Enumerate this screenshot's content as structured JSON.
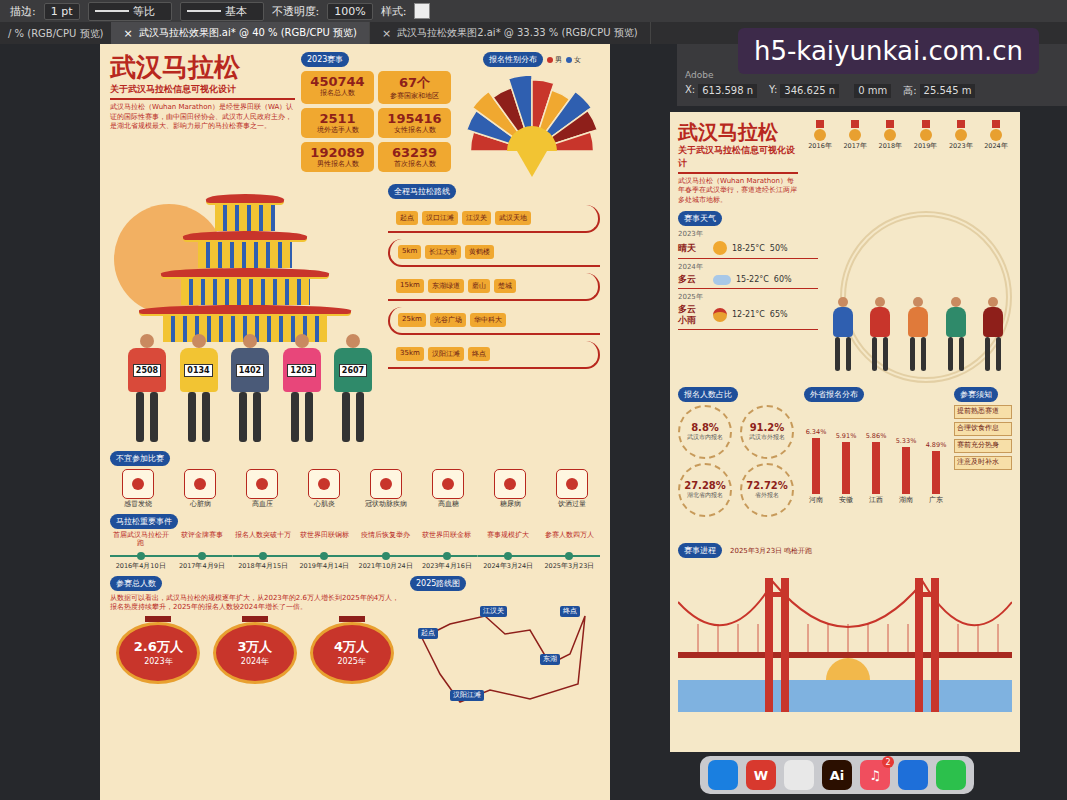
{
  "toolbar": {
    "stroke_label": "描边:",
    "stroke_value": "1 pt",
    "profile": "等比",
    "brush": "基本",
    "opacity_label": "不透明度:",
    "opacity_value": "100%",
    "style_label": "样式:"
  },
  "left_tab_stub": "/ % (RGB/CPU 预览)",
  "tabs": [
    {
      "label": "武汉马拉松效果图.ai* @ 40 % (RGB/CPU 预览)",
      "selected": true
    },
    {
      "label": "武汉马拉松效果图2.ai* @ 33.33 % (RGB/CPU 预览)",
      "selected": false
    }
  ],
  "tab_close": "×",
  "app_label": "Adobe",
  "watermark": "h5-kaiyunkai.com.cn",
  "transform": [
    {
      "label": "X:",
      "value": "613.598 n"
    },
    {
      "label": "Y:",
      "value": "346.625 n"
    },
    {
      "label": "",
      "value": "0 mm"
    },
    {
      "label": "高:",
      "value": "25.545 m"
    }
  ],
  "board1": {
    "title": "武汉马拉松",
    "subtitle": "关于武汉马拉松信息可视化设计",
    "intro": "武汉马拉松（Wuhan Marathon）是经世界田联（WA）认证的国际性赛事，由中国田径协会、武汉市人民政府主办，是湖北省规模最大、影响力最广的马拉松赛事之一。",
    "stats_title": "2023赛事",
    "stats": [
      {
        "value": "450744",
        "label": "报名总人数"
      },
      {
        "value": "67个",
        "label": "参赛国家和地区"
      },
      {
        "value": "2511",
        "label": "境外选手人数"
      },
      {
        "value": "195416",
        "label": "女性报名人数"
      },
      {
        "value": "192089",
        "label": "男性报名人数"
      },
      {
        "value": "63239",
        "label": "首次报名人数"
      }
    ],
    "fan_title": "报名性别分布",
    "fan_legend": [
      {
        "label": "男",
        "color": "#c8352b"
      },
      {
        "label": "女",
        "color": "#2f5fb0"
      }
    ],
    "fan_segments": [
      {
        "color": "#c8352b",
        "level": 0.7
      },
      {
        "color": "#2f5fb0",
        "level": 0.85
      },
      {
        "color": "#f0a830",
        "level": 0.95
      },
      {
        "color": "#8e1f1a",
        "level": 0.8
      },
      {
        "color": "#2f5fb0",
        "level": 1
      },
      {
        "color": "#c8352b",
        "level": 0.9
      },
      {
        "color": "#f0a830",
        "level": 0.75
      },
      {
        "color": "#2f5fb0",
        "level": 0.95
      },
      {
        "color": "#8e1f1a",
        "level": 0.85
      },
      {
        "color": "#c8352b",
        "level": 0.7
      }
    ],
    "bibs": [
      {
        "number": "2508",
        "color": "#d94a3a"
      },
      {
        "number": "0134",
        "color": "#f2c433"
      },
      {
        "number": "1402",
        "color": "#4a5a78"
      },
      {
        "number": "1203",
        "color": "#e8467a"
      },
      {
        "number": "2607",
        "color": "#2f8a6a"
      }
    ],
    "route_title": "全程马拉松路线",
    "route_rows": [
      [
        "起点",
        "汉口江滩",
        "江汉关",
        "武汉天地"
      ],
      [
        "5km",
        "长江大桥",
        "黄鹤楼"
      ],
      [
        "15km",
        "东湖绿道",
        "磨山",
        "楚城"
      ],
      [
        "25km",
        "光谷广场",
        "华中科大"
      ],
      [
        "35km",
        "汉阳江滩",
        "终点"
      ]
    ],
    "warn_title": "不宜参加比赛",
    "warn_items": [
      "感冒发烧",
      "心脏病",
      "高血压",
      "心肌炎",
      "冠状动脉疾病",
      "高血糖",
      "糖尿病",
      "饮酒过量"
    ],
    "events_title": "马拉松重要事件",
    "events": [
      {
        "date": "2016年4月10日",
        "text": "首届武汉马拉松开跑"
      },
      {
        "date": "2017年4月9日",
        "text": "获评金牌赛事"
      },
      {
        "date": "2018年4月15日",
        "text": "报名人数突破十万"
      },
      {
        "date": "2019年4月14日",
        "text": "获世界田联铜标"
      },
      {
        "date": "2021年10月24日",
        "text": "疫情后恢复举办"
      },
      {
        "date": "2023年4月16日",
        "text": "获世界田联金标"
      },
      {
        "date": "2024年3月24日",
        "text": "赛事规模扩大"
      },
      {
        "date": "2025年3月23日",
        "text": "参赛人数四万人"
      }
    ],
    "totals_title": "参赛总人数",
    "totals_desc": "从数据可以看出，武汉马拉松的规模逐年扩大，从2023年的2.6万人增长到2025年的4万人，报名热度持续攀升，2025年的报名人数较2024年增长了一倍。",
    "lanterns": [
      {
        "value": "2.6万人",
        "year": "2023年"
      },
      {
        "value": "3万人",
        "year": "2024年"
      },
      {
        "value": "4万人",
        "year": "2025年"
      }
    ],
    "map_title": "2025路线图",
    "map_pins": [
      "起点",
      "江汉关",
      "东湖",
      "终点",
      "汉阳江滩"
    ]
  },
  "board2": {
    "title": "武汉马拉松",
    "subtitle": "关于武汉马拉松信息可视化设计",
    "intro": "武汉马拉松（Wuhan Marathon）每年春季在武汉举行，赛道途经长江两岸多处城市地标。",
    "medals": [
      "2016年",
      "2017年",
      "2018年",
      "2019年",
      "2023年",
      "2024年"
    ],
    "weather_title": "赛事天气",
    "weather": [
      {
        "year": "2023年",
        "condition": "晴天",
        "kind": "sunny",
        "temp": "18-25°C",
        "humidity": "50%"
      },
      {
        "year": "2024年",
        "condition": "多云",
        "kind": "cloudy",
        "temp": "15-22°C",
        "humidity": "60%"
      },
      {
        "year": "2025年",
        "condition": "多云 小雨",
        "kind": "medal",
        "temp": "12-21°C",
        "humidity": "65%"
      }
    ],
    "runners": [
      {
        "color": "#2f5fb0"
      },
      {
        "color": "#c8352b"
      },
      {
        "color": "#e07a3a"
      },
      {
        "color": "#2f8a6a"
      },
      {
        "color": "#8e1f1a"
      }
    ],
    "share_title": "报名人数占比",
    "shares": [
      {
        "value": "8.8%",
        "label": "武汉市内报名"
      },
      {
        "value": "91.2%",
        "label": "武汉市外报名"
      },
      {
        "value": "27.28%",
        "label": "湖北省内报名"
      },
      {
        "value": "72.72%",
        "label": "省外报名"
      }
    ],
    "chart_title": "外省报名分布",
    "bars": [
      {
        "label": "河南",
        "value": 6.34,
        "text": "6.34%"
      },
      {
        "label": "安徽",
        "value": 5.91,
        "text": "5.91%"
      },
      {
        "label": "江西",
        "value": 5.86,
        "text": "5.86%"
      },
      {
        "label": "湖南",
        "value": 5.33,
        "text": "5.33%"
      },
      {
        "label": "广东",
        "value": 4.89,
        "text": "4.89%"
      }
    ],
    "notes_title": "参赛须知",
    "notes": [
      "提前熟悉赛道",
      "合理饮食作息",
      "赛前充分热身",
      "注意及时补水"
    ],
    "progress_title": "赛事进程",
    "progress_text": "2025年3月23日 鸣枪开跑"
  },
  "dock": [
    {
      "label": "",
      "color": "#1a7fe0",
      "badge": ""
    },
    {
      "label": "W",
      "color": "#d8392e",
      "badge": ""
    },
    {
      "label": "",
      "color": "#e8e8e8",
      "badge": ""
    },
    {
      "label": "Ai",
      "color": "#2b0f00",
      "badge": ""
    },
    {
      "label": "♫",
      "color": "#f04e5e",
      "badge": "2"
    },
    {
      "label": "",
      "color": "#1e6fd9",
      "badge": ""
    },
    {
      "label": "",
      "color": "#2cc04c",
      "badge": ""
    }
  ]
}
